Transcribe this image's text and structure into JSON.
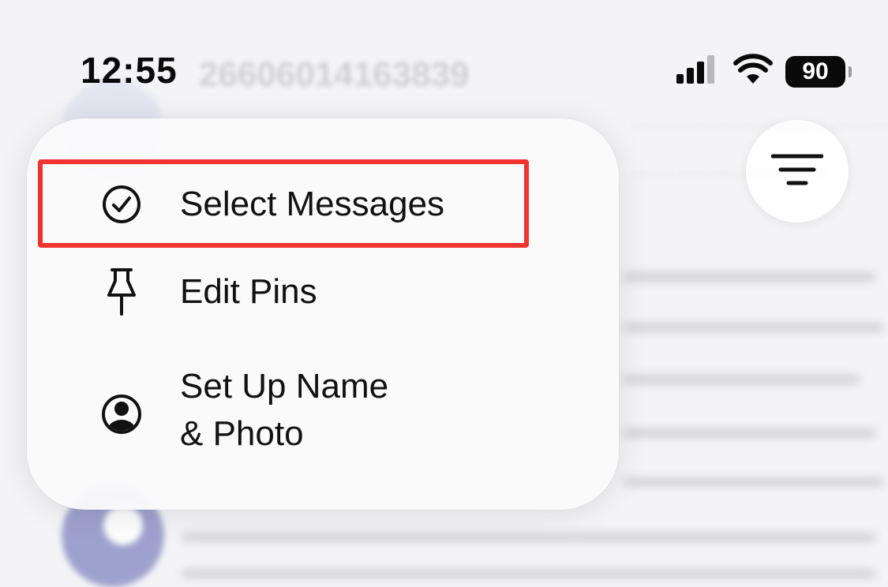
{
  "status_bar": {
    "time": "12:55",
    "battery_level": "90",
    "icons": [
      "cellular-signal-icon",
      "wifi-icon",
      "battery-icon"
    ]
  },
  "background": {
    "conversation_title": "26606014163839"
  },
  "menu": {
    "items": [
      {
        "label": "Select Messages",
        "icon": "checkmark-circle-icon",
        "highlighted": true
      },
      {
        "label": "Edit Pins",
        "icon": "pin-icon",
        "highlighted": false
      },
      {
        "label_line1": "Set Up Name",
        "label_line2": "& Photo",
        "icon": "person-circle-icon",
        "highlighted": false
      }
    ]
  },
  "filter_button": {
    "icon": "filter-lines-icon"
  },
  "colors": {
    "highlight": "#f0332f",
    "menu_background": "#fafafb",
    "text": "#111111"
  }
}
